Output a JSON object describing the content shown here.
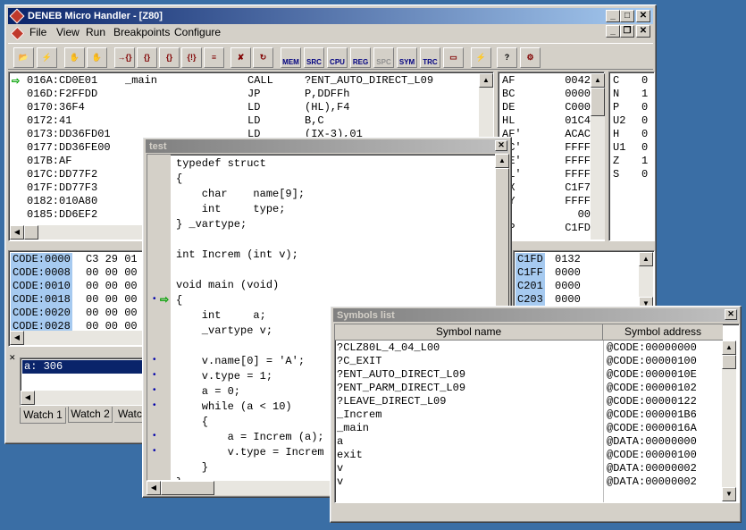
{
  "main": {
    "title": "DENEB Micro Handler - [Z80]",
    "menu": [
      "File",
      "View",
      "Run",
      "Breakpoints",
      "Configure"
    ],
    "toolbar": [
      "MEM",
      "SRC",
      "CPU",
      "REG",
      "SPC",
      "SYM",
      "TRC"
    ],
    "disasm": [
      {
        "addr": "016A:CD0E01",
        "label": "_main",
        "op": "CALL",
        "arg": "?ENT_AUTO_DIRECT_L09"
      },
      {
        "addr": "016D:F2FFDD",
        "label": "",
        "op": "JP",
        "arg": "P,DDFFh"
      },
      {
        "addr": "0170:36F4",
        "label": "",
        "op": "LD",
        "arg": "(HL),F4"
      },
      {
        "addr": "0172:41",
        "label": "",
        "op": "LD",
        "arg": "B,C"
      },
      {
        "addr": "0173:DD36FD01",
        "label": "",
        "op": "LD",
        "arg": "(IX-3),01"
      },
      {
        "addr": "0177:DD36FE00",
        "label": "",
        "op": "",
        "arg": ""
      },
      {
        "addr": "017B:AF",
        "label": "",
        "op": "",
        "arg": ""
      },
      {
        "addr": "017C:DD77F2",
        "label": "",
        "op": "",
        "arg": ""
      },
      {
        "addr": "017F:DD77F3",
        "label": "",
        "op": "",
        "arg": ""
      },
      {
        "addr": "0182:010A80",
        "label": "",
        "op": "",
        "arg": ""
      },
      {
        "addr": "0185:DD6EF2",
        "label": "",
        "op": "",
        "arg": ""
      }
    ],
    "registers": [
      {
        "name": "AF",
        "val": "0042"
      },
      {
        "name": "BC",
        "val": "0000"
      },
      {
        "name": "DE",
        "val": "C000"
      },
      {
        "name": "HL",
        "val": "01C4"
      },
      {
        "name": "AF'",
        "val": "ACAC"
      },
      {
        "name": "BC'",
        "val": "FFFF"
      },
      {
        "name": "DE'",
        "val": "FFFF"
      },
      {
        "name": "HL'",
        "val": "FFFF"
      },
      {
        "name": "IX",
        "val": "C1F7"
      },
      {
        "name": "IY",
        "val": "FFFF"
      },
      {
        "name": "I",
        "val": "00"
      },
      {
        "name": "SP",
        "val": "C1FD"
      }
    ],
    "flags": [
      {
        "name": "C",
        "val": "0"
      },
      {
        "name": "N",
        "val": "1"
      },
      {
        "name": "P",
        "val": "0"
      },
      {
        "name": "U2",
        "val": "0"
      },
      {
        "name": "H",
        "val": "0"
      },
      {
        "name": "U1",
        "val": "0"
      },
      {
        "name": "Z",
        "val": "1"
      },
      {
        "name": "S",
        "val": "0"
      }
    ],
    "memory": [
      {
        "addr": "CODE:0000",
        "bytes": "C3 29 01"
      },
      {
        "addr": "CODE:0008",
        "bytes": "00 00 00"
      },
      {
        "addr": "CODE:0010",
        "bytes": "00 00 00"
      },
      {
        "addr": "CODE:0018",
        "bytes": "00 00 00"
      },
      {
        "addr": "CODE:0020",
        "bytes": "00 00 00"
      },
      {
        "addr": "CODE:0028",
        "bytes": "00 00 00"
      }
    ],
    "stack": [
      {
        "addr": "C1FD",
        "val": "0132"
      },
      {
        "addr": "C1FF",
        "val": "0000"
      },
      {
        "addr": "C201",
        "val": "0000"
      },
      {
        "addr": "C203",
        "val": "0000"
      }
    ],
    "watch_value": "a: 306",
    "watch_tabs": [
      "Watch 1",
      "Watch 2",
      "Watc"
    ]
  },
  "source": {
    "title": "test",
    "lines": [
      "typedef struct",
      "{",
      "    char    name[9];",
      "    int     type;",
      "} _vartype;",
      "",
      "int Increm (int v);",
      "",
      "void main (void)",
      "{",
      "    int     a;",
      "    _vartype v;",
      "",
      "    v.name[0] = 'A';",
      "    v.type = 1;",
      "    a = 0;",
      "    while (a < 10)",
      "    {",
      "        a = Increm (a);",
      "        v.type = Increm",
      "    }",
      "}"
    ]
  },
  "symbols": {
    "title": "Symbols list",
    "col_name": "Symbol name",
    "col_addr": "Symbol address",
    "rows": [
      {
        "name": "?CLZ80L_4_04_L00",
        "addr": "@CODE:00000000"
      },
      {
        "name": "?C_EXIT",
        "addr": "@CODE:00000100"
      },
      {
        "name": "?ENT_AUTO_DIRECT_L09",
        "addr": "@CODE:0000010E"
      },
      {
        "name": "?ENT_PARM_DIRECT_L09",
        "addr": "@CODE:00000102"
      },
      {
        "name": "?LEAVE_DIRECT_L09",
        "addr": "@CODE:00000122"
      },
      {
        "name": "_Increm",
        "addr": "@CODE:000001B6"
      },
      {
        "name": "_main",
        "addr": "@CODE:0000016A"
      },
      {
        "name": "a",
        "addr": "@DATA:00000000"
      },
      {
        "name": "exit",
        "addr": "@CODE:00000100"
      },
      {
        "name": "v",
        "addr": "@DATA:00000002"
      },
      {
        "name": "v",
        "addr": "@DATA:00000002"
      }
    ]
  }
}
